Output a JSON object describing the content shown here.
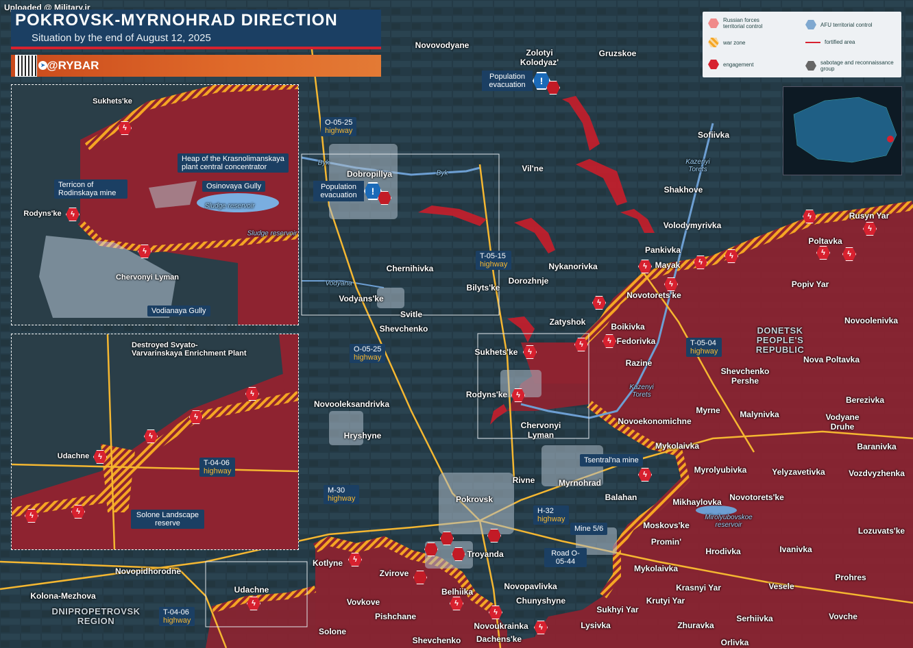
{
  "uploaded": "Uploaded @ Military.ir",
  "title": "POKROVSK-MYRNOHRAD DIRECTION",
  "subtitle": "Situation by the end of August 12, 2025",
  "brand": "@RYBAR",
  "legend": {
    "russian": "Russian forces territorial control",
    "afu": "AFU territorial control",
    "war_zone": "war zone",
    "fortified": "fortified area",
    "engagement": "engagement",
    "sabotage": "sabotage and reconnaissance group"
  },
  "colors": {
    "russian": "#8e2330",
    "afu": "#c8d8e8",
    "war_zone": "#f5a623",
    "engagement": "#d7212f",
    "water": "#7aaee0",
    "highway": "#f5b731"
  },
  "regions": {
    "donetsk": "DONETSK PEOPLE'S REPUBLIC",
    "dnipro": "DNIPROPETROVSK REGION"
  },
  "settlements": [
    "Novovodyane",
    "Zolotyi Kolodyaz'",
    "Gruzskoe",
    "Sofiivka",
    "Vil'ne",
    "Shakhove",
    "Dobropillya",
    "Volodymyrivka",
    "Pankivka",
    "Mayak",
    "Rusyn Yar",
    "Poltavka",
    "Popiv Yar",
    "Nykanorivka",
    "Chernihivka",
    "Bilyts'ke",
    "Dorozhnje",
    "Novotorets'ke",
    "Vodyans'ke",
    "Svitle",
    "Shevchenko",
    "Zatyshok",
    "Boikivka",
    "Fedorivka",
    "Novoolenivka",
    "Sukhets'ke",
    "Razine",
    "Shevchenko Pershe",
    "Nova Poltavka",
    "Rodyns'ke",
    "Novooleksandrivka",
    "Berezivka",
    "Myrne",
    "Malynivka",
    "Vodyane Druhe",
    "Chervonyi Lyman",
    "Novoekonomichne",
    "Hryshyne",
    "Baranivka",
    "Mykolaivka",
    "Myrolyubivka",
    "Yelyzavetivka",
    "Vozdvyzhenka",
    "Rivne",
    "Myrnohrad",
    "Pokrovsk",
    "Balahan",
    "Mikhaylovka",
    "Novotorets'ke",
    "Lozuvats'ke",
    "Moskovs'ke",
    "Promin'",
    "Hrodivka",
    "Ivanivka",
    "Kotlyne",
    "Troyanda",
    "Mykolaivka",
    "Prohres",
    "Novopidhorodne",
    "Zvirove",
    "Krasnyi Yar",
    "Vesele",
    "Novopavlivka",
    "Kolona-Mezhova",
    "Udachne",
    "Belhiika",
    "Chunyshyne",
    "Krutyi Yar",
    "Vovkove",
    "Sukhyi Yar",
    "Serhiivka",
    "Vovche",
    "Pishchane",
    "Zhuravka",
    "Novoukrainka",
    "Lysivka",
    "Solone",
    "Shevchenko",
    "Dachens'ke",
    "Orlivka"
  ],
  "water_labels": [
    "Byk",
    "Byk",
    "Kazenyi Torets",
    "Vodyana",
    "Kazenyi Torets",
    "Mirolyubovskoe reservoir"
  ],
  "highways": [
    {
      "code": "O-05-25",
      "label": "highway"
    },
    {
      "code": "T-05-15",
      "label": "highway"
    },
    {
      "code": "O-05-25",
      "label": "highway"
    },
    {
      "code": "T-05-04",
      "label": "highway"
    },
    {
      "code": "M-30",
      "label": "highway"
    },
    {
      "code": "H-32",
      "label": "highway"
    },
    {
      "code": "Road O-05-44",
      "label": ""
    },
    {
      "code": "T-04-06",
      "label": "highway"
    }
  ],
  "callouts": {
    "mine_central": "Tsentral'na mine",
    "mine56": "Mine 5/6",
    "evac1": "Population evacuation",
    "evac2": "Population evacuation"
  },
  "inset1": {
    "sukhetske": "Sukhets'ke",
    "heap": "Heap of the Krasnolimanskaya plant central concentrator",
    "terricon": "Terricon of Rodinskaya mine",
    "osinovaya": "Osinovaya Gully",
    "sludge1": "Sludge reservoir",
    "sludge2": "Sludge reservoir",
    "rodynske": "Rodyns'ke",
    "chervonyi": "Chervonyi Lyman",
    "vodianaya": "Vodianaya Gully"
  },
  "inset2": {
    "plant": "Destroyed Svyato-Varvarinskaya Enrichment Plant",
    "udachne": "Udachne",
    "hw_code": "T-04-06",
    "hw_label": "highway",
    "solone": "Solone Landscape reserve"
  }
}
